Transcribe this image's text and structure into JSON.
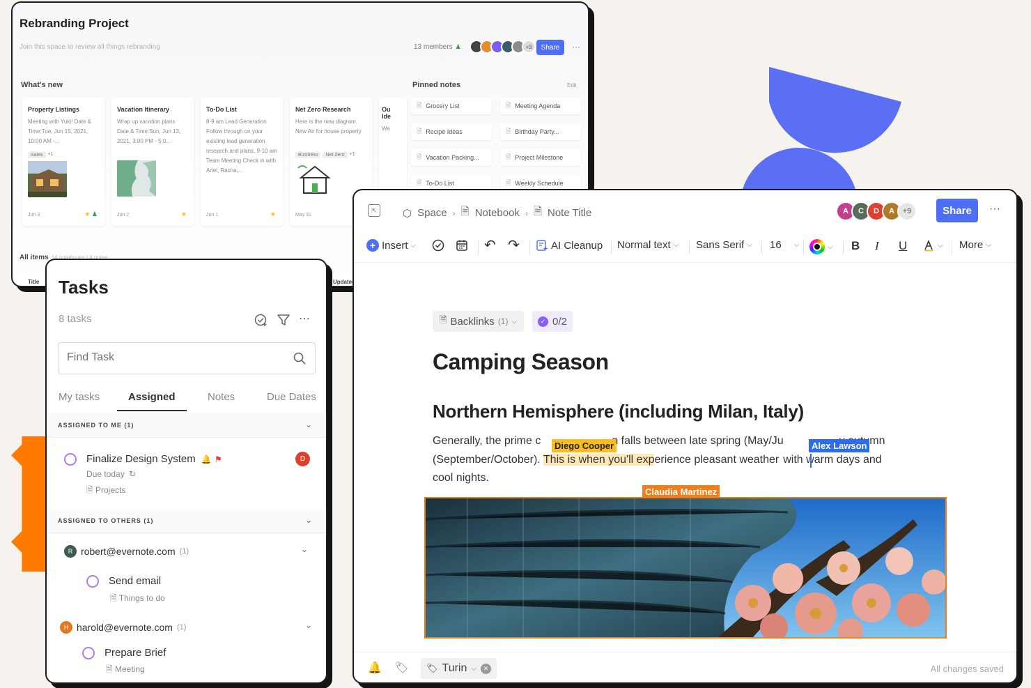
{
  "rebranding": {
    "title": "Rebranding Project",
    "subtitle": "Join this space to review all things rebranding",
    "members": "13 members",
    "avatars_more": "+9",
    "share_label": "Share",
    "more_label": "···",
    "whats_new_label": "What's new",
    "cards": [
      {
        "title": "Property Listings",
        "body": "Meeting with Yuki! Date & Time:Tue, Jun 15, 2021, 10:00 AM -...",
        "tags": [
          "Sales",
          "+1"
        ],
        "date": "Jun 3"
      },
      {
        "title": "Vacation Itinerary",
        "body": "Wrap up vacation plans Date & Time:Sun, Jun 13, 2021, 3:00 PM - 5:0...",
        "tags": [],
        "date": "Jun 2"
      },
      {
        "title": "To-Do List",
        "body": "8-9 am Lead Generation Follow through on your existing lead generation research and plans. 9-10 am Team Meeting Check in with Ariel, Rasha,...",
        "tags": [],
        "date": "Jun 1"
      },
      {
        "title": "Net Zero Research",
        "body": "Here is the new diagram. New Air for house property",
        "tags": [
          "Business",
          "Net Zero",
          "+1"
        ],
        "date": "May 31"
      },
      {
        "title": "Ou Ide",
        "body": "Wa",
        "tags": [],
        "date": ""
      }
    ],
    "pinned_label": "Pinned notes",
    "pinned_edit": "Edit",
    "pinned": [
      "Grocery List",
      "Meeting Agenda",
      "Recipe Ideas",
      "Birthday Party...",
      "Vacation Packing...",
      "Project Milestone",
      "To-Do List",
      "Weekly Schedule"
    ],
    "all_items_label": "All items",
    "all_items_sub": "14 notebooks | 4 notes",
    "col_title": "Title",
    "col_updated": "Updated"
  },
  "tasks": {
    "title": "Tasks",
    "count": "8 tasks",
    "search_placeholder": "Find Task",
    "tabs": [
      "My tasks",
      "Assigned",
      "Notes",
      "Due Dates"
    ],
    "section_me": "ASSIGNED TO ME (1)",
    "task1": {
      "name": "Finalize Design System",
      "due": "Due today",
      "notebook": "Projects",
      "assignee_initial": "D"
    },
    "section_others": "ASSIGNED TO OTHERS (1)",
    "user1": {
      "initial": "R",
      "email": "robert@evernote.com",
      "count": "(1)",
      "task": "Send email",
      "notebook": "Things to do"
    },
    "user2": {
      "initial": "H",
      "email": "harold@evernote.com",
      "count": "(1)",
      "task": "Prepare Brief",
      "notebook": "Meeting"
    }
  },
  "editor": {
    "breadcrumb": [
      "Space",
      "Notebook",
      "Note Title"
    ],
    "avatars": [
      {
        "initial": "A",
        "color": "#c2408c"
      },
      {
        "initial": "C",
        "color": "#5a6b5c"
      },
      {
        "initial": "D",
        "color": "#e0402e"
      },
      {
        "initial": "A",
        "color": "#b07a2a"
      }
    ],
    "avatars_more": "+9",
    "share_label": "Share",
    "more_label": "···",
    "toolbar": {
      "insert": "Insert",
      "ai_cleanup": "AI Cleanup",
      "text_style": "Normal text",
      "font": "Sans Serif",
      "size": "16",
      "more": "More"
    },
    "backlinks_label": "Backlinks",
    "backlinks_count": "(1)",
    "progress": "0/2",
    "title": "Camping Season",
    "heading": "Northern Hemisphere (including Milan, Italy)",
    "para1_a": "Generally, the prime c",
    "para1_b": "n falls between late spring (May/Ju",
    "para1_c": "y autumn",
    "para2_a": "(September/October). ",
    "para2_hl_a": "This is when you'll exp",
    "para2_b": "erience pleasant weather",
    "para2_c": "with warm days and",
    "para3": "cool nights.",
    "cursor_diego": "Diego Cooper",
    "cursor_alex": "Alex Lawson",
    "cursor_claudia": "Claudia Martinez",
    "tag_label": "Turin",
    "saved_status": "All changes saved"
  }
}
